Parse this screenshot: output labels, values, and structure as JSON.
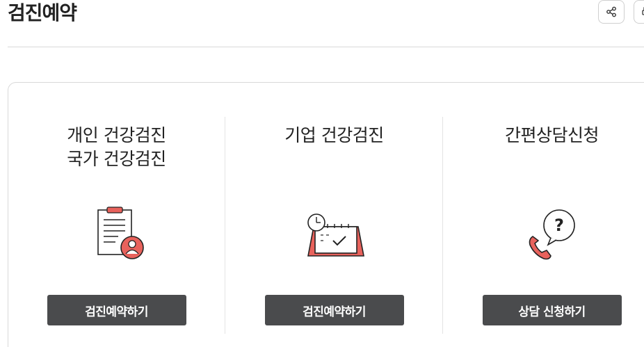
{
  "header": {
    "title": "검진예약"
  },
  "toolbar": {
    "share_icon": "share-icon",
    "print_icon": "print-icon"
  },
  "columns": [
    {
      "title_lines": [
        "개인 건강검진",
        "국가 건강검진"
      ],
      "icon": "clipboard-person-icon",
      "button_label": "검진예약하기"
    },
    {
      "title_lines": [
        "기업 건강검진"
      ],
      "icon": "desk-calendar-clock-icon",
      "button_label": "검진예약하기"
    },
    {
      "title_lines": [
        "간편상담신청"
      ],
      "icon": "phone-question-icon",
      "button_label": "상담 신청하기"
    }
  ],
  "colors": {
    "accent": "#e8625c",
    "button_bg": "#4a4b4d",
    "border": "#d9d9d9"
  }
}
